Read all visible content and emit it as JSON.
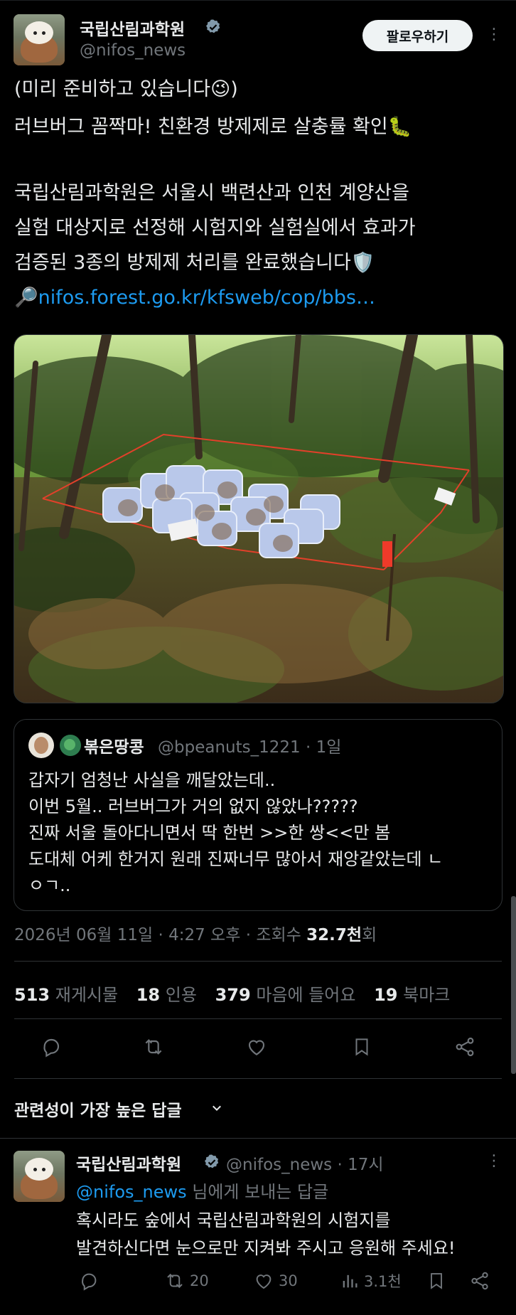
{
  "post": {
    "author_name": "국립산림과학원",
    "handle": "@nifos_news",
    "follow_label": "팔로우하기",
    "text_lines": [
      "(미리 준비하고 있습니다😉)",
      "러브버그 꼼짝마! 친환경 방제제로 살충률 확인🐛",
      "국립산림과학원은 서울시 백련산과 인천 계양산을",
      "실험 대상지로 선정해 시험지와 실험실에서 효과가",
      "검증된 3종의 방제제 처리를 완료했습니다🛡️"
    ],
    "link_prefix": "🔎",
    "link_text": "nifos.forest.go.kr/kfsweb/cop/bbs…"
  },
  "quote": {
    "name": "볶은땅콩",
    "handle_time": "@bpeanuts_1221 · 1일",
    "lines": [
      "갑자기 엄청난 사실을 깨달았는데..",
      "이번 5월.. 러브버그가 거의 없지 않았나?????",
      "진짜 서울 돌아다니면서 딱 한번 >>한 쌍<<만 봄",
      "도대체 어케 한거지 원래 진짜너무 많아서 재앙같았는데 ㄴ",
      "ㅇㄱ.."
    ]
  },
  "meta": {
    "timestamp": "2026년 06월 11일 · 4:27 오후 · ",
    "views_label": "조회수 ",
    "views_count": "32.7천",
    "views_suffix": "회"
  },
  "stats": {
    "reposts_count": "513",
    "reposts_label": "재게시물",
    "quotes_count": "18",
    "quotes_label": "인용",
    "likes_count": "379",
    "likes_label": "마음에 들어요",
    "bookmarks_count": "19",
    "bookmarks_label": "북마크"
  },
  "replies_sort_label": "관련성이 가장 높은 답글",
  "reply": {
    "author_name": "국립산림과학원",
    "handle_time": "@nifos_news · 17시",
    "reply_to_handle": "@nifos_news",
    "reply_to_suffix": " 님에게 보내는 답글",
    "lines": [
      "혹시라도 숲에서 국립산림과학원의 시험지를",
      "발견하신다면 눈으로만 지켜봐 주시고 응원해 주세요!"
    ],
    "reposts": "20",
    "likes": "30",
    "views": "3.1천"
  },
  "colors": {
    "accent": "#1d9bf0",
    "verified": "#829aab",
    "background": "#000000",
    "muted": "#71767b"
  },
  "icons": [
    "verified-badge-icon",
    "more-icon",
    "reply-icon",
    "repost-icon",
    "like-icon",
    "bookmark-icon",
    "share-icon",
    "chevron-down-icon",
    "views-icon"
  ]
}
